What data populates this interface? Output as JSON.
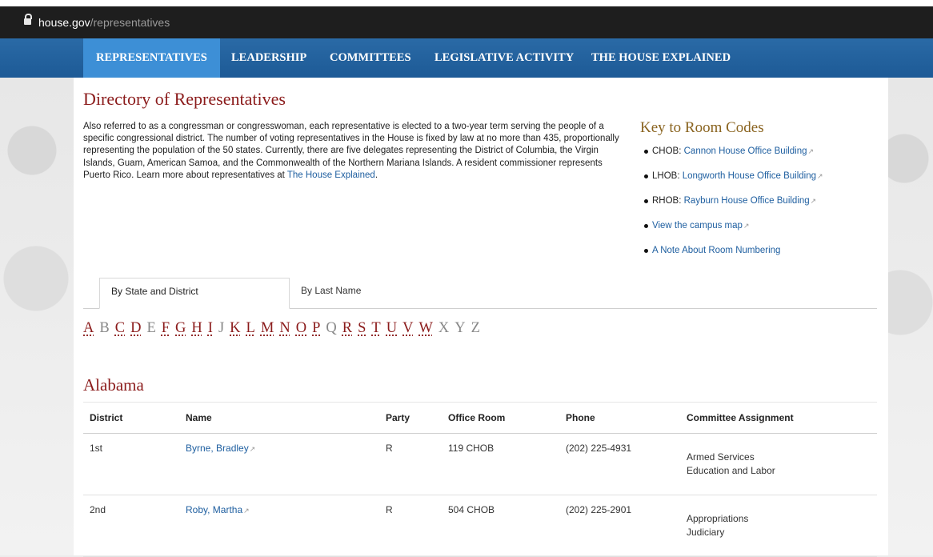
{
  "browser": {
    "url_domain": "house.gov",
    "url_path": "/representatives"
  },
  "nav": {
    "items": [
      "REPRESENTATIVES",
      "LEADERSHIP",
      "COMMITTEES",
      "LEGISLATIVE ACTIVITY",
      "THE HOUSE EXPLAINED"
    ],
    "active": "REPRESENTATIVES"
  },
  "page": {
    "title": "Directory of Representatives",
    "intro": "Also referred to as a congressman or congresswoman, each representative is elected to a two-year term serving the people of a specific congressional district. The number of voting representatives in the House is fixed by law at no more than 435, proportionally representing the population of the 50 states. Currently, there are five delegates representing the District of Columbia, the Virgin Islands, Guam, American Samoa, and the Commonwealth of the Northern Mariana Islands. A resident commissioner represents Puerto Rico. Learn more about representatives at ",
    "intro_link": "The House Explained",
    "intro_end": "."
  },
  "key": {
    "title": "Key to Room Codes",
    "items": [
      {
        "code": "CHOB: ",
        "link": "Cannon House Office Building"
      },
      {
        "code": "LHOB: ",
        "link": "Longworth House Office Building"
      },
      {
        "code": "RHOB: ",
        "link": "Rayburn House Office Building"
      },
      {
        "code": "",
        "link": "View the campus map"
      },
      {
        "code": "",
        "link": "A Note About Room Numbering"
      }
    ]
  },
  "tabs": {
    "by_state": "By State and District",
    "by_last_name": "By Last Name"
  },
  "letters": [
    {
      "l": "A",
      "link": true
    },
    {
      "l": "B",
      "link": false
    },
    {
      "l": "C",
      "link": true
    },
    {
      "l": "D",
      "link": true
    },
    {
      "l": "E",
      "link": false
    },
    {
      "l": "F",
      "link": true
    },
    {
      "l": "G",
      "link": true
    },
    {
      "l": "H",
      "link": true
    },
    {
      "l": "I",
      "link": true
    },
    {
      "l": "J",
      "link": false
    },
    {
      "l": "K",
      "link": true
    },
    {
      "l": "L",
      "link": true
    },
    {
      "l": "M",
      "link": true
    },
    {
      "l": "N",
      "link": true
    },
    {
      "l": "O",
      "link": true
    },
    {
      "l": "P",
      "link": true
    },
    {
      "l": "Q",
      "link": false
    },
    {
      "l": "R",
      "link": true
    },
    {
      "l": "S",
      "link": true
    },
    {
      "l": "T",
      "link": true
    },
    {
      "l": "U",
      "link": true
    },
    {
      "l": "V",
      "link": true
    },
    {
      "l": "W",
      "link": true
    },
    {
      "l": "X",
      "link": false
    },
    {
      "l": "Y",
      "link": false
    },
    {
      "l": "Z",
      "link": false
    }
  ],
  "state": {
    "name": "Alabama",
    "columns": [
      "District",
      "Name",
      "Party",
      "Office Room",
      "Phone",
      "Committee Assignment"
    ],
    "rows": [
      {
        "district": "1st",
        "name": "Byrne, Bradley",
        "party": "R",
        "office": "119 CHOB",
        "phone": "(202) 225-4931",
        "committees": [
          "Armed Services",
          "Education and Labor"
        ]
      },
      {
        "district": "2nd",
        "name": "Roby, Martha",
        "party": "R",
        "office": "504 CHOB",
        "phone": "(202) 225-2901",
        "committees": [
          "Appropriations",
          "Judiciary"
        ]
      }
    ]
  }
}
